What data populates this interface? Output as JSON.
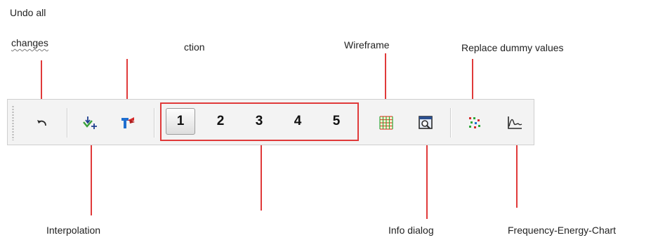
{
  "callouts": {
    "undo_line1": "Undo all",
    "undo_line2": "changes",
    "section": "ction",
    "wireframe": "Wireframe",
    "replace_dummy": "Replace dummy  values",
    "interpolation": "Interpolation",
    "info_dialog": "Info dialog",
    "frequency_energy": "Frequency-Energy-Chart"
  },
  "toolbar": {
    "view_buttons": [
      "1",
      "2",
      "3",
      "4",
      "5"
    ],
    "active_view": "1"
  },
  "colors": {
    "callout_line": "#e03a3a",
    "toolbar_bg": "#f3f3f3",
    "toolbar_border": "#cfcfcf"
  }
}
